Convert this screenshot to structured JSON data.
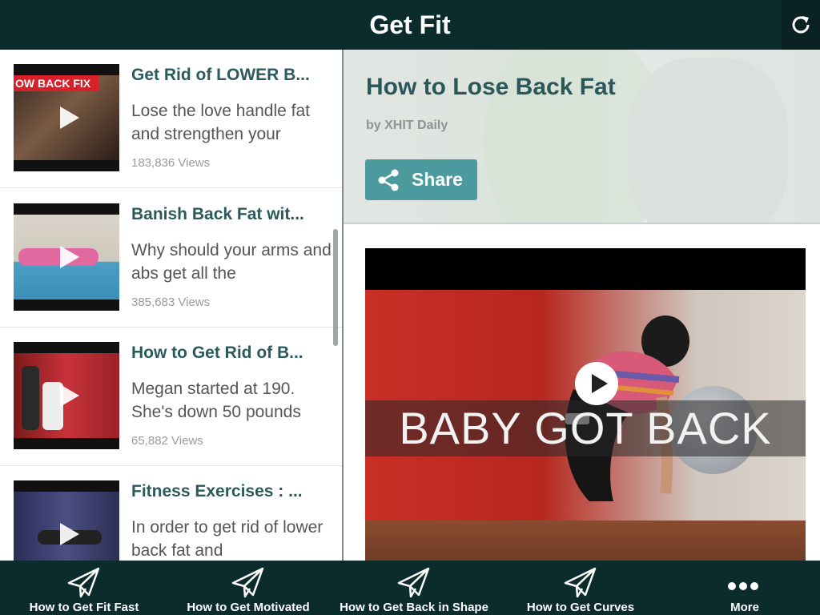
{
  "app": {
    "title": "Get Fit"
  },
  "list": {
    "items": [
      {
        "title": "Get Rid of LOWER B...",
        "description": "Lose the love handle fat and strengthen your",
        "views": "183,836 Views",
        "thumb_text": "OW BACK FIX"
      },
      {
        "title": "Banish Back Fat wit...",
        "description": "Why should your arms and abs get all the",
        "views": "385,683 Views"
      },
      {
        "title": "How to Get Rid of B...",
        "description": "Megan started at 190. She's down 50 pounds",
        "views": "65,882 Views"
      },
      {
        "title": "Fitness Exercises : ...",
        "description": "In order to get rid of lower back fat and",
        "views": ""
      }
    ]
  },
  "article": {
    "title": "How to Lose Back Fat",
    "byline": "by XHIT Daily",
    "share_label": "Share",
    "video_caption": "BABY GOT BACK"
  },
  "bottom_nav": {
    "tabs": [
      {
        "label": "How to Get Fit Fast",
        "icon": "paper-plane-icon"
      },
      {
        "label": "How to Get Motivated",
        "icon": "paper-plane-icon"
      },
      {
        "label": "How to Get Back in Shape",
        "icon": "paper-plane-icon"
      },
      {
        "label": "How to Get Curves",
        "icon": "paper-plane-icon"
      },
      {
        "label": "More",
        "icon": "more-dots-icon"
      }
    ]
  },
  "colors": {
    "bar": "#0b2b2c",
    "accent": "#4a9a9e",
    "title_text": "#2c5758"
  }
}
